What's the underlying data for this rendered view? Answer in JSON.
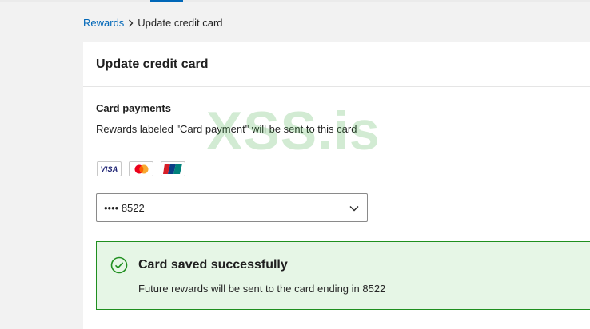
{
  "breadcrumb": {
    "parent": "Rewards",
    "current": "Update credit card"
  },
  "card": {
    "title": "Update credit card",
    "section_title": "Card payments",
    "description": "Rewards labeled \"Card payment\" will be sent to this card",
    "accepted_cards": [
      {
        "name": "visa",
        "label": "VISA"
      },
      {
        "name": "mastercard",
        "label": ""
      },
      {
        "name": "unionpay",
        "label": ""
      }
    ],
    "selected_card": "•••• 8522"
  },
  "alert": {
    "title": "Card saved successfully",
    "message": "Future rewards will be sent to the card ending in 8522"
  },
  "watermark": "XSS.is",
  "colors": {
    "link": "#0067b8",
    "success_border": "#1f8f1f",
    "success_bg": "#e6f6e6",
    "page_bg": "#f2f2f2"
  }
}
